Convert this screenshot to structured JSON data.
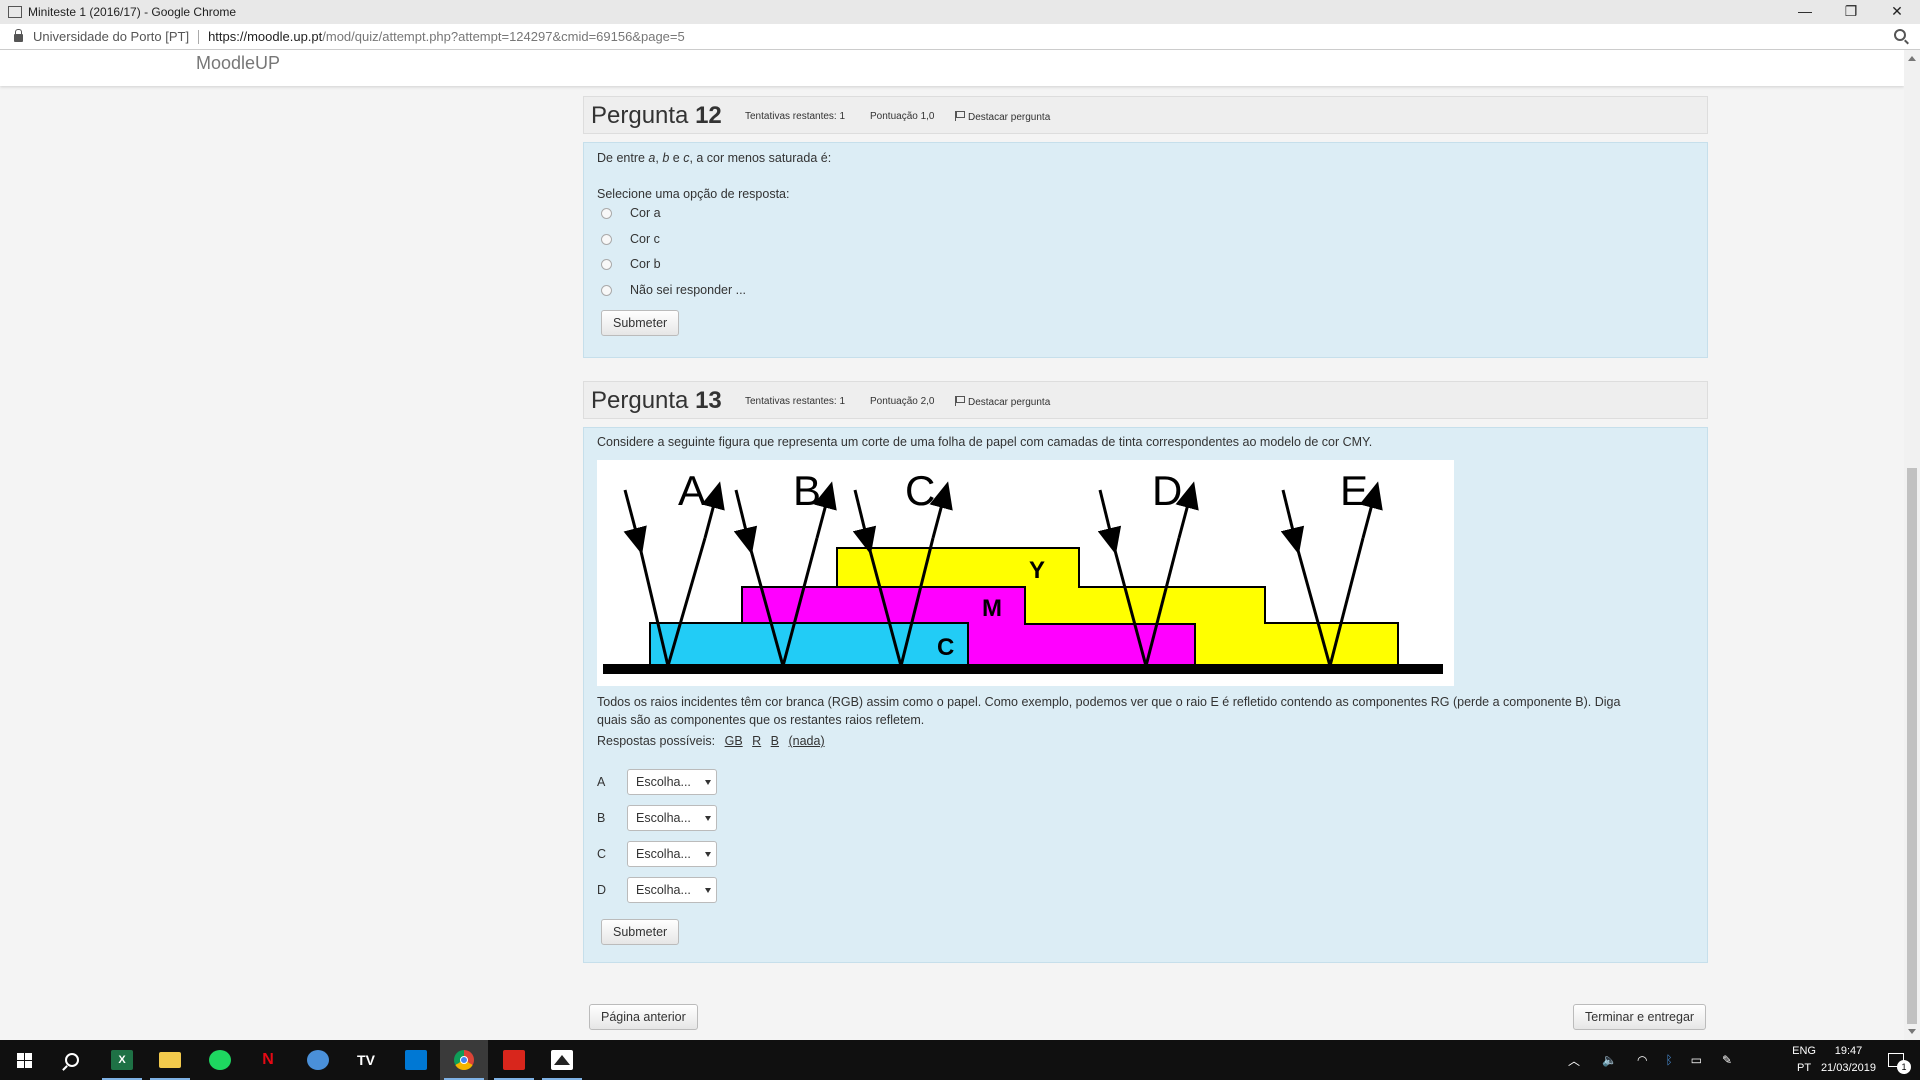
{
  "window": {
    "title": "Miniteste 1 (2016/17) - Google Chrome",
    "minimize": "—",
    "maximize": "❐",
    "close": "✕"
  },
  "address": {
    "site_name": "Universidade do Porto [PT]",
    "url_main": "https://moodle.up.pt",
    "url_rest": "/mod/quiz/attempt.php?attempt=124297&cmid=69156&page=5"
  },
  "brand": "MoodleUP",
  "q12": {
    "title_prefix": "Pergunta ",
    "number": "12",
    "attempts": "Tentativas restantes: 1",
    "score": "Pontuação 1,0",
    "flag": "Destacar pergunta",
    "prompt_parts": [
      "De entre ",
      "a",
      ", ",
      "b",
      " e ",
      "c",
      ", a cor menos saturada é:"
    ],
    "select_label": "Selecione uma opção de resposta:",
    "options": [
      "Cor a",
      "Cor c",
      "Cor b",
      "Não sei responder ..."
    ],
    "submit": "Submeter"
  },
  "q13": {
    "title_prefix": "Pergunta ",
    "number": "13",
    "attempts": "Tentativas restantes: 1",
    "score": "Pontuação 2,0",
    "flag": "Destacar pergunta",
    "prompt": "Considere a seguinte figura que representa um corte de uma folha de papel com camadas de tinta correspondentes ao modelo de cor CMY.",
    "figure": {
      "ray_labels": [
        "A",
        "B",
        "C",
        "D",
        "E"
      ],
      "layer_labels": {
        "y": "Y",
        "m": "M",
        "c": "C"
      },
      "colors": {
        "cyan": "#22ccf6",
        "magenta": "#ff00ff",
        "yellow": "#ffff00"
      }
    },
    "description_line1": "Todos os raios incidentes têm cor branca (RGB) assim como o papel. Como exemplo, podemos ver que o raio E é refletido contendo as componentes RG (perde a componente B). Diga",
    "description_line2": "quais são as componentes que os restantes raios refletem.",
    "answers_label": "Respostas possíveis:",
    "answers": [
      "GB",
      "R",
      "B",
      "(nada)"
    ],
    "subquestions": [
      {
        "label": "A",
        "value": "Escolha..."
      },
      {
        "label": "B",
        "value": "Escolha..."
      },
      {
        "label": "C",
        "value": "Escolha..."
      },
      {
        "label": "D",
        "value": "Escolha..."
      }
    ],
    "submit": "Submeter"
  },
  "nav": {
    "prev": "Página anterior",
    "finish": "Terminar e entregar"
  },
  "taskbar": {
    "icons": [
      "windows-start",
      "search",
      "excel",
      "file-explorer",
      "spotify",
      "netflix",
      "outlook",
      "tv",
      "vscode",
      "chrome",
      "acrobat",
      "photos"
    ],
    "excel_label": "X",
    "netflix_label": "N",
    "tv_label": "TV",
    "lang_top": "ENG",
    "lang_bottom": "PT",
    "time": "19:47",
    "date": "21/03/2019",
    "notifications": "1"
  }
}
